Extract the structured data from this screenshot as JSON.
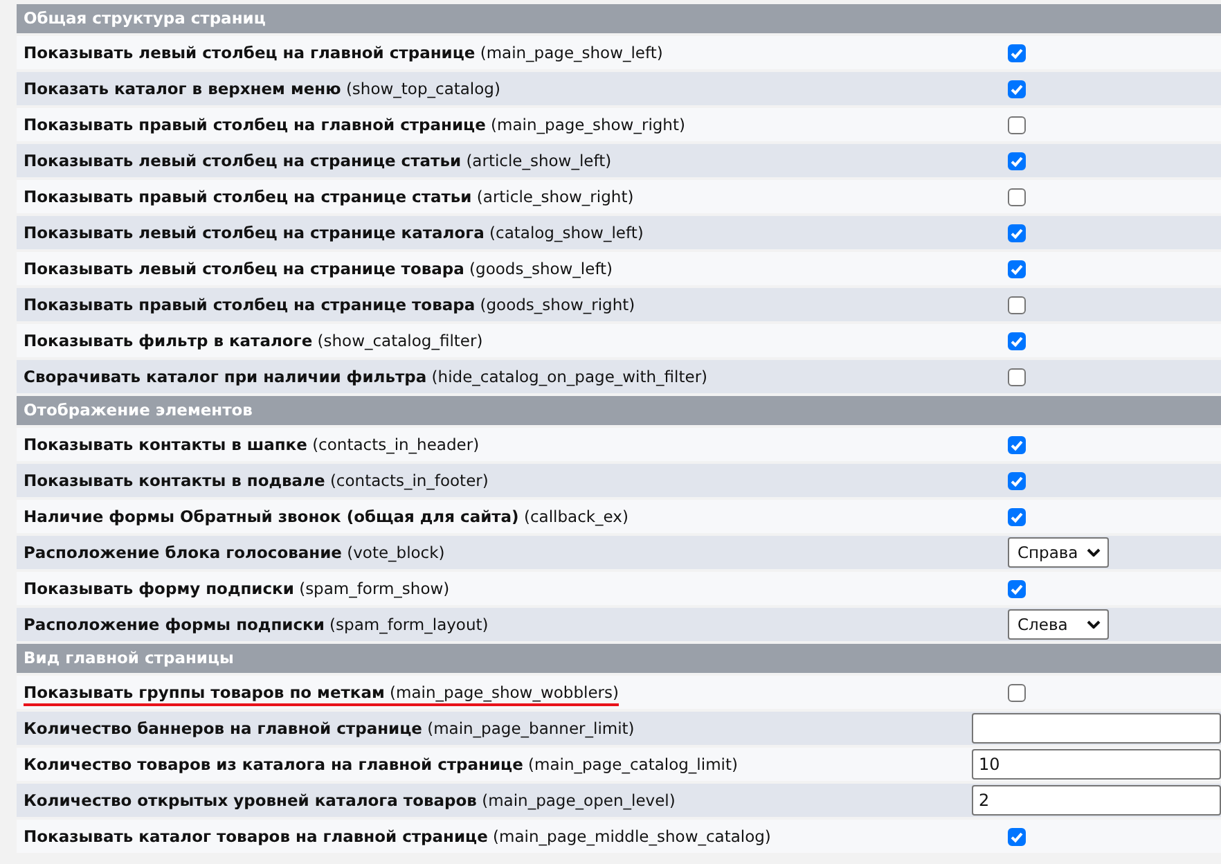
{
  "sections": [
    {
      "title": "Общая структура страниц",
      "rows": [
        {
          "kind": "checkbox",
          "label": "Показывать левый столбец на главной странице",
          "key": "(main_page_show_left)",
          "checked": true
        },
        {
          "kind": "checkbox",
          "label": "Показать каталог в верхнем меню",
          "key": "(show_top_catalog)",
          "checked": true
        },
        {
          "kind": "checkbox",
          "label": "Показывать правый столбец на главной странице",
          "key": "(main_page_show_right)",
          "checked": false
        },
        {
          "kind": "checkbox",
          "label": "Показывать левый столбец на странице статьи",
          "key": "(article_show_left)",
          "checked": true
        },
        {
          "kind": "checkbox",
          "label": "Показывать правый столбец на странице статьи",
          "key": "(article_show_right)",
          "checked": false
        },
        {
          "kind": "checkbox",
          "label": "Показывать левый столбец на странице каталога",
          "key": "(catalog_show_left)",
          "checked": true
        },
        {
          "kind": "checkbox",
          "label": "Показывать левый столбец на странице товара",
          "key": "(goods_show_left)",
          "checked": true
        },
        {
          "kind": "checkbox",
          "label": "Показывать правый столбец на странице товара",
          "key": "(goods_show_right)",
          "checked": false
        },
        {
          "kind": "checkbox",
          "label": "Показывать фильтр в каталоге",
          "key": "(show_catalog_filter)",
          "checked": true
        },
        {
          "kind": "checkbox",
          "label": "Сворачивать каталог при наличии фильтра",
          "key": "(hide_catalog_on_page_with_filter)",
          "checked": false
        }
      ]
    },
    {
      "title": "Отображение элементов",
      "rows": [
        {
          "kind": "checkbox",
          "label": "Показывать контакты в шапке",
          "key": "(contacts_in_header)",
          "checked": true
        },
        {
          "kind": "checkbox",
          "label": "Показывать контакты в подвале",
          "key": "(contacts_in_footer)",
          "checked": true
        },
        {
          "kind": "checkbox",
          "label": "Наличие формы Обратный звонок (общая для сайта)",
          "key": "(callback_ex)",
          "checked": true
        },
        {
          "kind": "select",
          "label": "Расположение блока голосование",
          "key": "(vote_block)",
          "value": "Справа"
        },
        {
          "kind": "checkbox",
          "label": "Показывать форму подписки",
          "key": "(spam_form_show)",
          "checked": true
        },
        {
          "kind": "select",
          "label": "Расположение формы подписки",
          "key": "(spam_form_layout)",
          "value": "Слева"
        }
      ]
    },
    {
      "title": "Вид главной страницы",
      "rows": [
        {
          "kind": "checkbox",
          "label": "Показывать группы товаров по меткам",
          "key": "(main_page_show_wobblers)",
          "checked": false,
          "underlined": true
        },
        {
          "kind": "input",
          "label": "Количество баннеров на главной странице",
          "key": "(main_page_banner_limit)"
        },
        {
          "kind": "input",
          "label": "Количество товаров из каталога на главной странице",
          "key": "(main_page_catalog_limit)",
          "value": "10"
        },
        {
          "kind": "input",
          "label": "Количество открытых уровней каталога товаров",
          "key": "(main_page_open_level)",
          "value": "2"
        },
        {
          "kind": "checkbox",
          "label": "Показывать каталог товаров на главной странице",
          "key": "(main_page_middle_show_catalog)",
          "checked": true
        }
      ]
    }
  ]
}
